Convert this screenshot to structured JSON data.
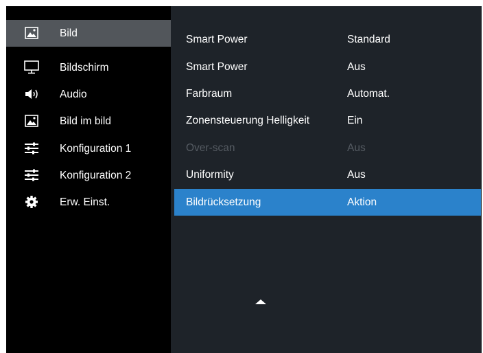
{
  "sidebar": {
    "items": [
      {
        "label": "Bild",
        "icon": "picture-icon",
        "selected": true
      },
      {
        "label": "Bildschirm",
        "icon": "monitor-icon",
        "selected": false
      },
      {
        "label": "Audio",
        "icon": "speaker-icon",
        "selected": false
      },
      {
        "label": "Bild im bild",
        "icon": "picture-in-picture-icon",
        "selected": false
      },
      {
        "label": "Konfiguration 1",
        "icon": "sliders-icon",
        "selected": false
      },
      {
        "label": "Konfiguration 2",
        "icon": "sliders-icon",
        "selected": false
      },
      {
        "label": "Erw. Einst.",
        "icon": "gear-icon",
        "selected": false
      }
    ]
  },
  "settings": {
    "rows": [
      {
        "name": "Smart Power",
        "value": "Standard",
        "state": "normal"
      },
      {
        "name": "Smart Power",
        "value": "Aus",
        "state": "normal"
      },
      {
        "name": "Farbraum",
        "value": "Automat.",
        "state": "normal"
      },
      {
        "name": "Zonensteuerung Helligkeit",
        "value": "Ein",
        "state": "normal"
      },
      {
        "name": "Over-scan",
        "value": "Aus",
        "state": "disabled"
      },
      {
        "name": "Uniformity",
        "value": "Aus",
        "state": "normal"
      },
      {
        "name": "Bildrücksetzung",
        "value": "Aktion",
        "state": "highlighted"
      }
    ]
  },
  "colors": {
    "sidebar_selected": "#52565b",
    "panel_background": "#1e2329",
    "highlight": "#2b82cb",
    "disabled_text": "#555b62"
  },
  "scroll_indicator": {
    "icon": "scroll-up-arrow-icon"
  }
}
